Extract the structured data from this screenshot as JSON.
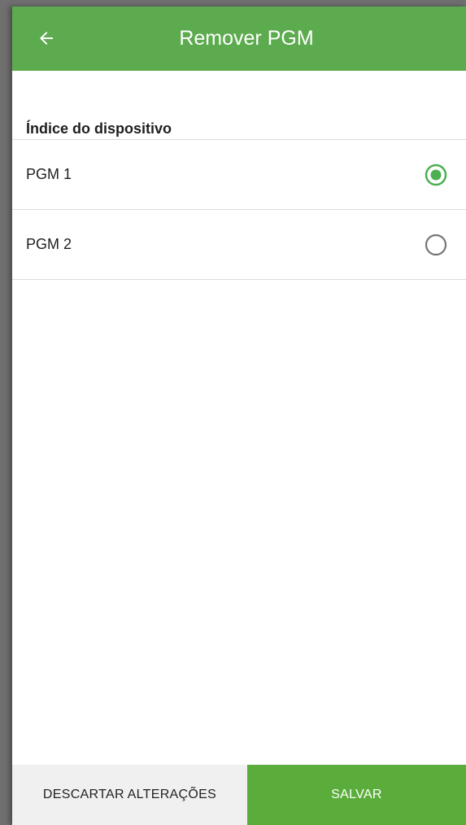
{
  "app_bar": {
    "title": "Remover PGM",
    "back_icon": "arrow-left-icon",
    "color": "#5cab4e"
  },
  "section": {
    "title": "Índice do dispositivo"
  },
  "options": [
    {
      "label": "PGM 1",
      "selected": true
    },
    {
      "label": "PGM 2",
      "selected": false
    }
  ],
  "bottom_bar": {
    "discard_label": "DESCARTAR ALTERAÇÕES",
    "save_label": "SALVAR",
    "save_color": "#5aad3a"
  },
  "colors": {
    "accent": "#4caf50",
    "radio_unselected": "#757575"
  }
}
